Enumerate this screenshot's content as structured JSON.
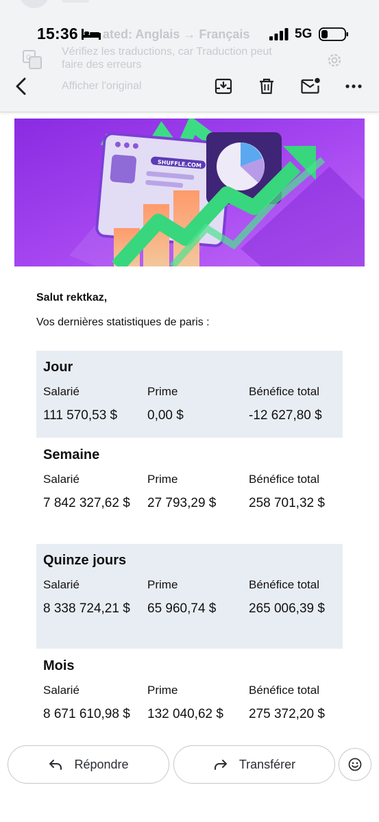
{
  "status_bar": {
    "time": "15:36",
    "network": "5G"
  },
  "translation": {
    "title": "ated: Anglais → Français",
    "note": "Vérifiez les traductions, car Traduction peut faire des erreurs",
    "show_original": "Afficher l'original"
  },
  "toolbar": {
    "icons": [
      "back-icon",
      "archive-icon",
      "trash-icon",
      "mark-unread-icon",
      "more-icon"
    ]
  },
  "email": {
    "greeting": "Salut rektkaz,",
    "intro": "Vos dernières statistiques de paris :",
    "blocks": [
      {
        "title": "Jour",
        "labels": [
          "Salarié",
          "Prime",
          "Bénéfice total"
        ],
        "values": [
          "111 570,53 $",
          "0,00 $",
          "-12 627,80 $"
        ]
      },
      {
        "title": "Semaine",
        "labels": [
          "Salarié",
          "Prime",
          "Bénéfice total"
        ],
        "values": [
          "7 842 327,62 $",
          "27 793,29 $",
          "258 701,32 $"
        ]
      },
      {
        "title": "Quinze jours",
        "labels": [
          "Salarié",
          "Prime",
          "Bénéfice total"
        ],
        "values": [
          "8 338 724,21 $",
          "65 960,74 $",
          "265 006,39 $"
        ]
      },
      {
        "title": "Mois",
        "labels": [
          "Salarié",
          "Prime",
          "Bénéfice total"
        ],
        "values": [
          "8 671 610,98 $",
          "132 040,62 $",
          "275 372,20 $"
        ]
      }
    ]
  },
  "banner": {
    "brand": "SHUFFLE.COM",
    "colors": {
      "purple": "#a23ff2",
      "green": "#3ddc84"
    }
  },
  "actions": {
    "reply": "Répondre",
    "forward": "Transférer"
  }
}
